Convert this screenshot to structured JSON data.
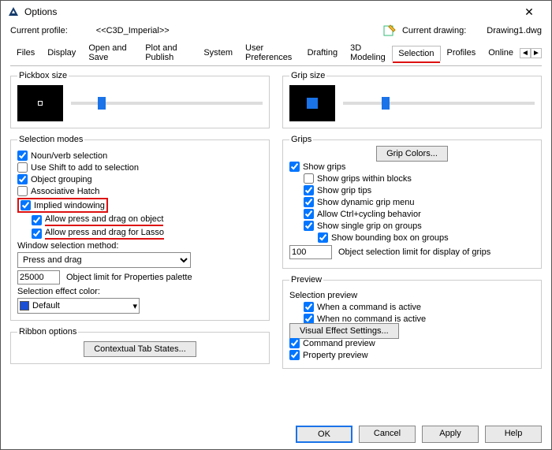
{
  "window": {
    "title": "Options"
  },
  "info": {
    "profile_label": "Current profile:",
    "profile_value": "<<C3D_Imperial>>",
    "drawing_label": "Current drawing:",
    "drawing_value": "Drawing1.dwg"
  },
  "tabs": {
    "items": [
      {
        "label": "Files"
      },
      {
        "label": "Display"
      },
      {
        "label": "Open and Save"
      },
      {
        "label": "Plot and Publish"
      },
      {
        "label": "System"
      },
      {
        "label": "User Preferences"
      },
      {
        "label": "Drafting"
      },
      {
        "label": "3D Modeling"
      },
      {
        "label": "Selection"
      },
      {
        "label": "Profiles"
      },
      {
        "label": "Online"
      }
    ],
    "active": "Selection"
  },
  "pickbox": {
    "legend": "Pickbox size"
  },
  "gripsize": {
    "legend": "Grip size"
  },
  "selection_modes": {
    "legend": "Selection modes",
    "noun_verb": "Noun/verb selection",
    "shift_add": "Use Shift to add to selection",
    "obj_group": "Object grouping",
    "assoc_hatch": "Associative Hatch",
    "implied": "Implied windowing",
    "press_drag_obj": "Allow press and drag on object",
    "press_drag_lasso": "Allow press and drag for Lasso",
    "win_sel_label": "Window selection method:",
    "win_sel_value": "Press and drag",
    "obj_limit_value": "25000",
    "obj_limit_label": "Object limit for Properties palette",
    "sel_effect_label": "Selection effect color:",
    "sel_effect_value": "Default"
  },
  "ribbon": {
    "legend": "Ribbon options",
    "ctx_btn": "Contextual Tab States..."
  },
  "grips": {
    "legend": "Grips",
    "colors_btn": "Grip Colors...",
    "show_grips": "Show grips",
    "within_blocks": "Show grips within blocks",
    "grip_tips": "Show grip tips",
    "dyn_menu": "Show dynamic grip menu",
    "ctrl_cycle": "Allow Ctrl+cycling behavior",
    "single_group": "Show single grip on groups",
    "bbox_group": "Show bounding box on groups",
    "obj_sel_limit_value": "100",
    "obj_sel_limit_label": "Object selection limit for display of grips"
  },
  "preview": {
    "legend": "Preview",
    "sel_prev_label": "Selection preview",
    "cmd_active": "When a command is active",
    "no_cmd_active": "When no command is active",
    "vfx_btn": "Visual Effect Settings...",
    "cmd_preview": "Command preview",
    "prop_preview": "Property preview"
  },
  "buttons": {
    "ok": "OK",
    "cancel": "Cancel",
    "apply": "Apply",
    "help": "Help"
  }
}
